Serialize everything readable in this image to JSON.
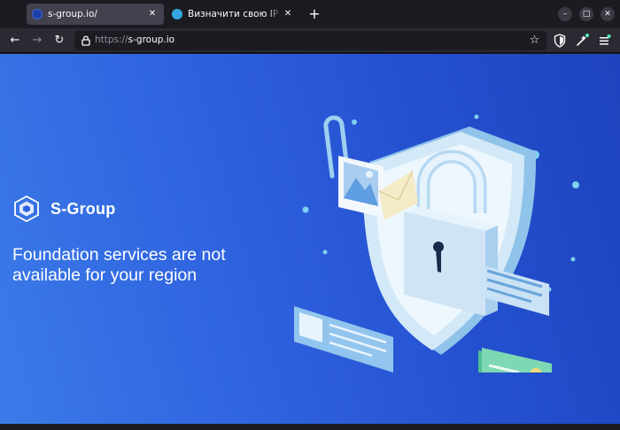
{
  "tabs": [
    {
      "title": "s-group.io/",
      "active": true
    },
    {
      "title": "Визначити свою IP адресу",
      "active": false
    }
  ],
  "new_tab_label": "+",
  "window_controls": {
    "minimize": "–",
    "maximize": "□",
    "close": "✕"
  },
  "nav": {
    "back": "←",
    "forward": "→",
    "reload": "↻"
  },
  "url": {
    "scheme": "https://",
    "host": "s-group.io"
  },
  "page": {
    "brand_name": "S-Group",
    "headline": "Foundation services are not available for your region"
  },
  "colors": {
    "page_gradient_start": "#3b7be8",
    "page_gradient_end": "#1d43bd",
    "shield": "#cfe6f7",
    "card_green": "#5cc9a0",
    "envelope": "#f4ebc7"
  },
  "icons": [
    "tab-favicon-icon",
    "lock-icon",
    "star-icon",
    "shield-toolbar-icon",
    "extensions-icon",
    "menu-icon",
    "s-group-logo-icon"
  ]
}
